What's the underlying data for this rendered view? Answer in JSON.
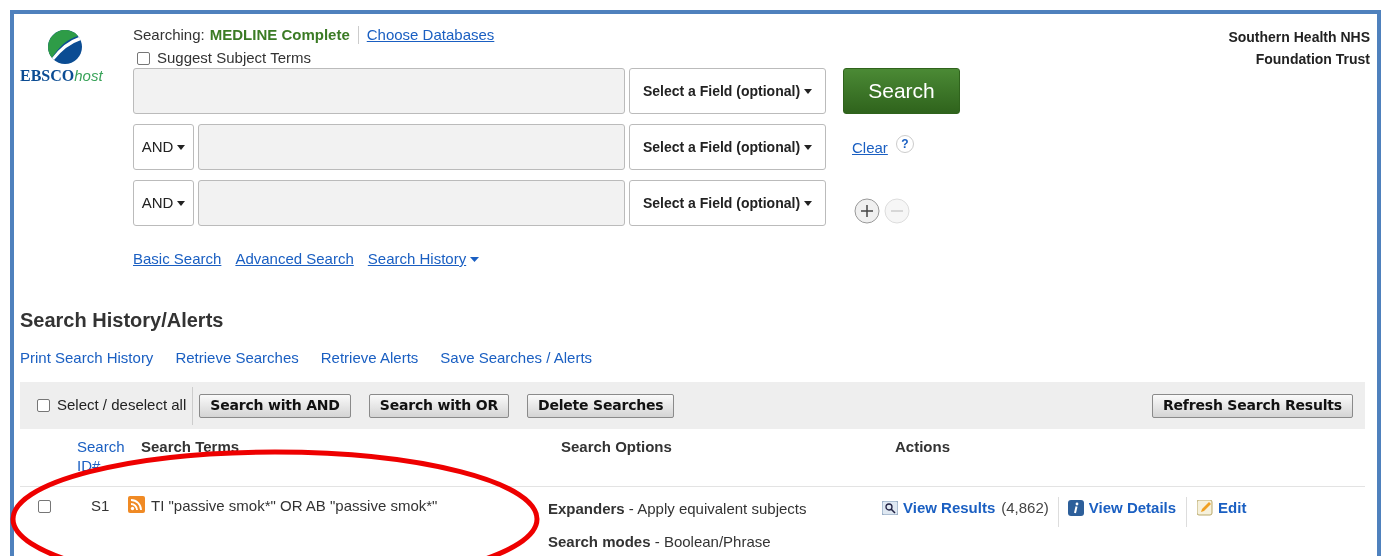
{
  "header": {
    "logo": {
      "word": "EBSCO",
      "suffix": "host"
    },
    "searching_label": "Searching:",
    "database": "MEDLINE Complete",
    "choose_link": "Choose Databases",
    "suggest": {
      "label": "Suggest Subject Terms",
      "checked": false
    },
    "institution": [
      "Southern Health NHS",
      "Foundation Trust"
    ]
  },
  "search_rows": [
    {
      "operator": "",
      "field": "Select a Field (optional)",
      "kind": "search"
    },
    {
      "operator": "AND",
      "field": "Select a Field (optional)",
      "kind": "clear"
    },
    {
      "operator": "AND",
      "field": "Select a Field (optional)",
      "kind": "addremove"
    }
  ],
  "search_button": "Search",
  "clear_link": "Clear",
  "help_glyph": "?",
  "nav_links": [
    {
      "label": "Basic Search",
      "caret": false
    },
    {
      "label": "Advanced Search",
      "caret": false
    },
    {
      "label": "Search History",
      "caret": true
    }
  ],
  "history": {
    "title": "Search History/Alerts",
    "links": [
      "Print Search History",
      "Retrieve Searches",
      "Retrieve Alerts",
      "Save Searches / Alerts"
    ],
    "toolbar": {
      "select_all": {
        "label": "Select / deselect all",
        "checked": false
      },
      "buttons": [
        "Search with AND",
        "Search with OR",
        "Delete Searches"
      ],
      "refresh": "Refresh Search Results"
    },
    "columns": [
      "Search ID#",
      "Search Terms",
      "Search Options",
      "Actions"
    ],
    "rows": [
      {
        "checked": false,
        "id": "S1",
        "terms": "TI \"passive smok*\" OR AB \"passive smok*\"",
        "options": [
          {
            "label": "Expanders",
            "value": " - Apply equivalent subjects"
          },
          {
            "label": "Search modes",
            "value": " - Boolean/Phrase"
          }
        ],
        "view_results": "View Results",
        "count": "(4,862)",
        "view_details": "View Details",
        "edit": "Edit"
      }
    ]
  }
}
